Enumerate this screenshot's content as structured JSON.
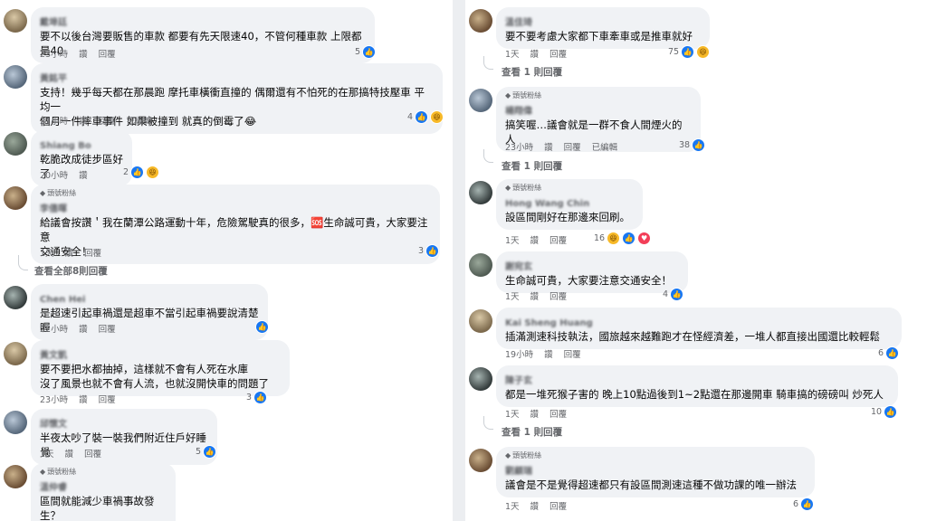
{
  "ui": {
    "reply": "回覆",
    "like": "讚",
    "edited": "已編輯",
    "top_fan": "頭號粉絲"
  },
  "left": {
    "comments": [
      {
        "name": "戴埠廷",
        "text": "要不以後台灣要販售的車款 都要有先天限速40，不管何種車款 上限都是40",
        "time": "23小時",
        "reactions": "5"
      },
      {
        "name": "黃銘平",
        "text": "支持！幾乎每天都在那晨跑 摩托車橫衝直撞的 偶爾還有不怕死的在那搞特技壓車 平均一\n個月一件摔車事件 如果被撞到 就真的倒霉了😂",
        "time": "21小時",
        "reactions": "4"
      },
      {
        "name": "Shiang Bo",
        "text": "乾脆改成徒步區好了",
        "time": "20小時",
        "reactions": "2"
      },
      {
        "name": "李僖暉",
        "text": "給議會按讚＇我在蘭潭公路運動十年，危險駕駛真的很多，🆘生命誠可貴，大家要注意\n交通安全！",
        "time": "1天",
        "reactions": "3"
      },
      {
        "name": "Chen Hei",
        "text": "是超速引起車禍還是超車不當引起車禍要說清楚喔",
        "time": "22小時",
        "reactions": ""
      },
      {
        "name": "黃文凱",
        "text": "要不要把水都抽掉，這樣就不會有人死在水庫\n沒了風景也就不會有人流，也就沒開快車的問題了",
        "time": "23小時",
        "reactions": "3"
      },
      {
        "name": "邱懷文",
        "text": "半夜太吵了裝一裝我們附近住戶好睡覺",
        "time": "1天",
        "reactions": "5"
      },
      {
        "name": "溫仲睿",
        "text": "區間就能減少車禍事故發生？\n一切事在人為",
        "time": "",
        "reactions": ""
      }
    ],
    "view_all_replies": "查看全部8則回覆"
  },
  "right": {
    "comments": [
      {
        "name": "溫佳琦",
        "text": "要不要考慮大家都下車牽車或是推車就好",
        "time": "1天",
        "reactions": "75"
      },
      {
        "name": "楊翔偉",
        "text": "搞笑喔…議會就是一群不食人間煙火的人",
        "time": "23小時",
        "reactions": "38"
      },
      {
        "name": "Hong Wang Chin",
        "text": "設區間剛好在那邊來回刷。",
        "time": "1天",
        "reactions": "16"
      },
      {
        "name": "謝宛玄",
        "text": "生命誠可貴，大家要注意交通安全！",
        "time": "1天",
        "reactions": "4"
      },
      {
        "name": "Kai Sheng Huang",
        "text": "插滿測速科技執法，國旅越來越難跑才在怪經濟差，一堆人都直接出國還比較輕鬆",
        "time": "19小時",
        "reactions": "6"
      },
      {
        "name": "陳子玄",
        "text": "都是一堆死猴子害的 晚上10點過後到1~2點還在那邊開車 騎車搞的磅磅叫 炒死人",
        "time": "1天",
        "reactions": "10"
      },
      {
        "name": "劉顧瑞",
        "text": "議會是不是覺得超速都只有設區間測速這種不做功課的唯一辦法",
        "time": "1天",
        "reactions": "6"
      }
    ],
    "view_one_reply": "查看 1 則回覆"
  }
}
